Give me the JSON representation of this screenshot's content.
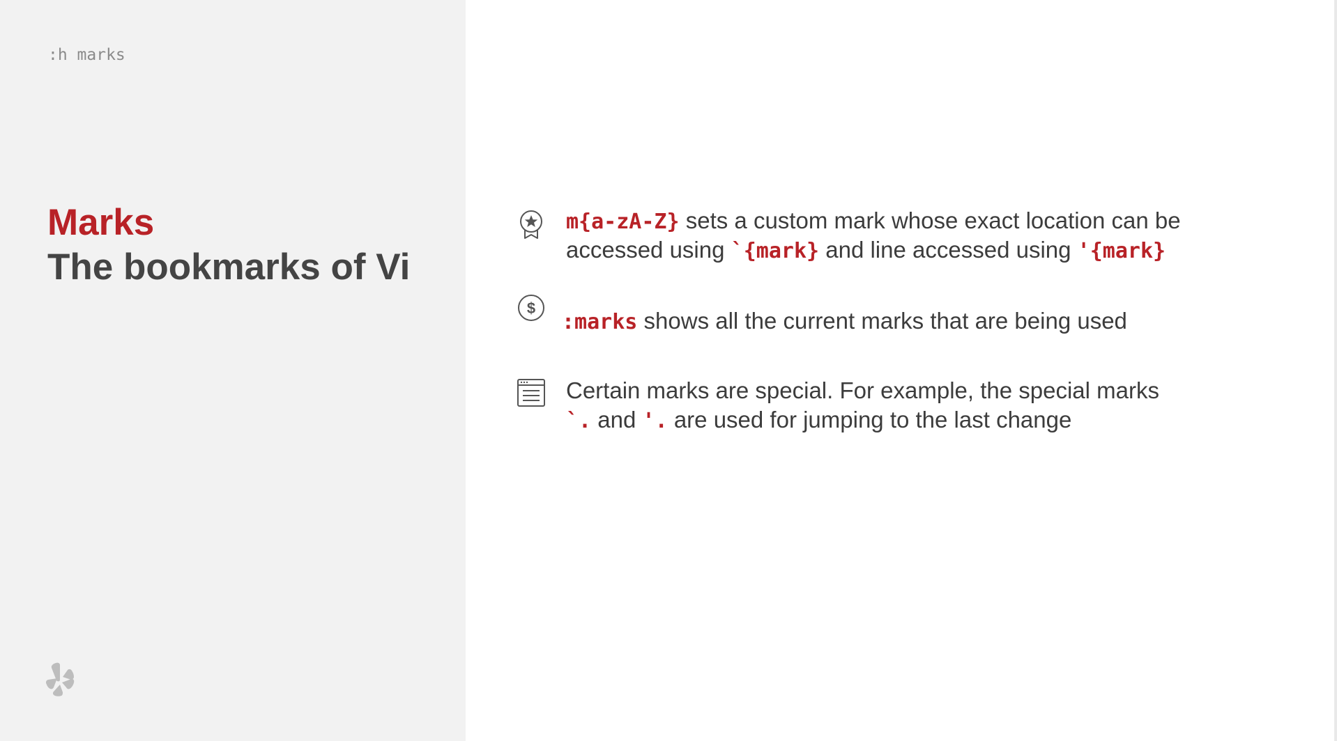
{
  "slide": {
    "help_command": ":h marks",
    "title": "Marks",
    "subtitle": "The bookmarks of Vi",
    "logo_icon": "yelp-burst-icon",
    "accent_color": "#b82227",
    "panel_color": "#f2f2f2"
  },
  "bullets": [
    {
      "icon": "award-ribbon-icon",
      "line1": {
        "code": "m{a-zA-Z}",
        "text": " sets a custom mark whose exact location can be"
      },
      "line2": {
        "text_a": "accessed using ",
        "code_a": "`{mark}",
        "text_b": "  and line accessed using ",
        "code_b": "'{mark}"
      }
    },
    {
      "icon": "dollar-coin-icon",
      "line1": {
        "code": ":marks",
        "text": "  shows all the current marks that are being used"
      }
    },
    {
      "icon": "document-window-icon",
      "line1": {
        "text": "Certain marks are special. For example, the special marks"
      },
      "line2": {
        "code_a": "`.",
        "text_a": "  and ",
        "code_b": "'.",
        "text_b": " are used for jumping to the last change"
      }
    }
  ]
}
